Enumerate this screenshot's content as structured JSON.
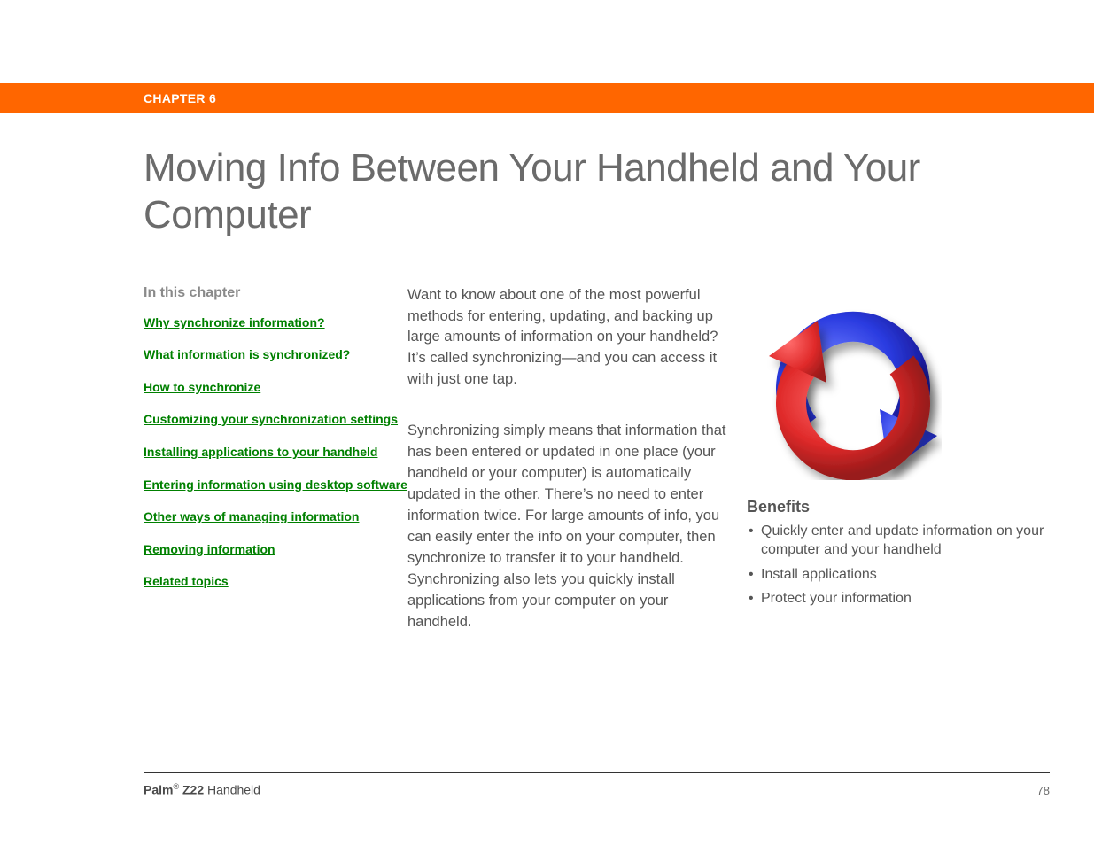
{
  "header": {
    "chapter_label": "CHAPTER 6"
  },
  "title": "Moving Info Between Your Handheld and Your Computer",
  "sidebar": {
    "heading": "In this chapter",
    "links": [
      "Why synchronize information?",
      "What information is synchronized?",
      "How to synchronize",
      "Customizing your synchronization settings",
      "Installing applications to your handheld",
      "Entering information using desktop software",
      "Other ways of managing information",
      "Removing information",
      "Related topics"
    ]
  },
  "body": {
    "p1": "Want to know about one of the most powerful methods for entering, updating, and backing up large amounts of information on your handheld? It’s called synchronizing—and you can access it with just one tap.",
    "p2": "Synchronizing simply means that information that has been entered or updated in one place (your handheld or your computer) is automatically updated in the other. There’s no need to enter information twice. For large amounts of info, you can easily enter the info on your computer, then synchronize to transfer it to your handheld. Synchronizing also lets you quickly install applications from your computer on your handheld."
  },
  "benefits": {
    "heading": "Benefits",
    "items": [
      "Quickly enter and update information on your computer and your handheld",
      "Install applications",
      "Protect your information"
    ]
  },
  "footer": {
    "brand": "Palm",
    "reg": "®",
    "model": "Z22",
    "product": "Handheld",
    "page": "78"
  }
}
